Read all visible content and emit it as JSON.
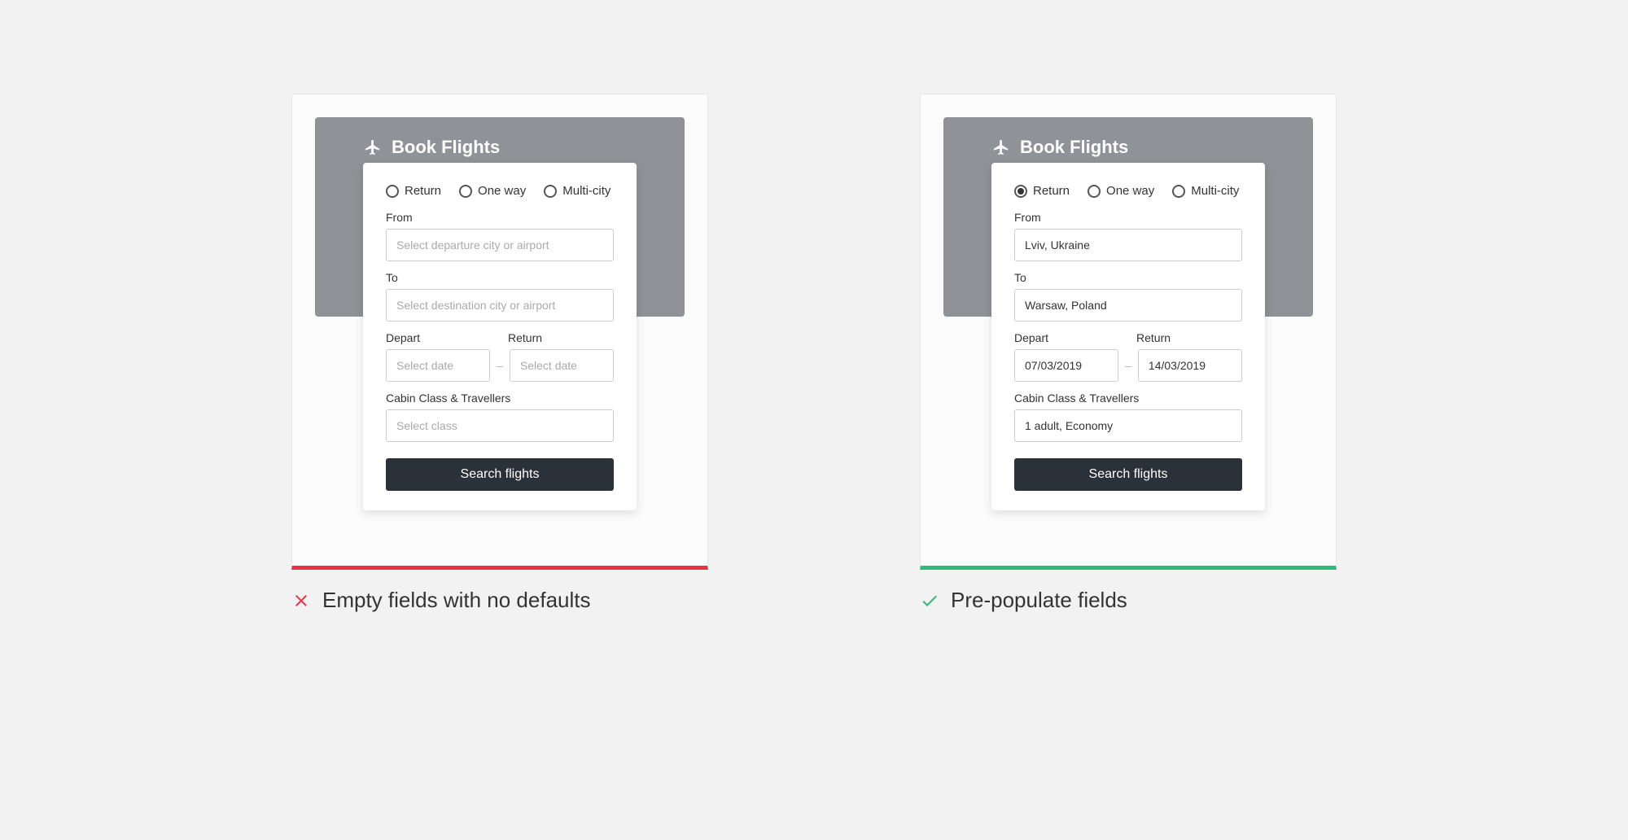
{
  "header_title": "Book Flights",
  "radios": {
    "return": "Return",
    "oneway": "One way",
    "multicity": "Multi-city"
  },
  "labels": {
    "from": "From",
    "to": "To",
    "depart": "Depart",
    "return": "Return",
    "cabin": "Cabin Class & Travellers"
  },
  "button": "Search flights",
  "bad": {
    "placeholders": {
      "from": "Select departure city or airport",
      "to": "Select destination city or airport",
      "depart": "Select date",
      "return": "Select date",
      "cabin": "Select class"
    },
    "caption": "Empty fields with no defaults"
  },
  "good": {
    "values": {
      "from": "Lviv, Ukraine",
      "to": "Warsaw, Poland",
      "depart": "07/03/2019",
      "return": "14/03/2019",
      "cabin": "1 adult, Economy"
    },
    "caption": "Pre-populate fields"
  }
}
